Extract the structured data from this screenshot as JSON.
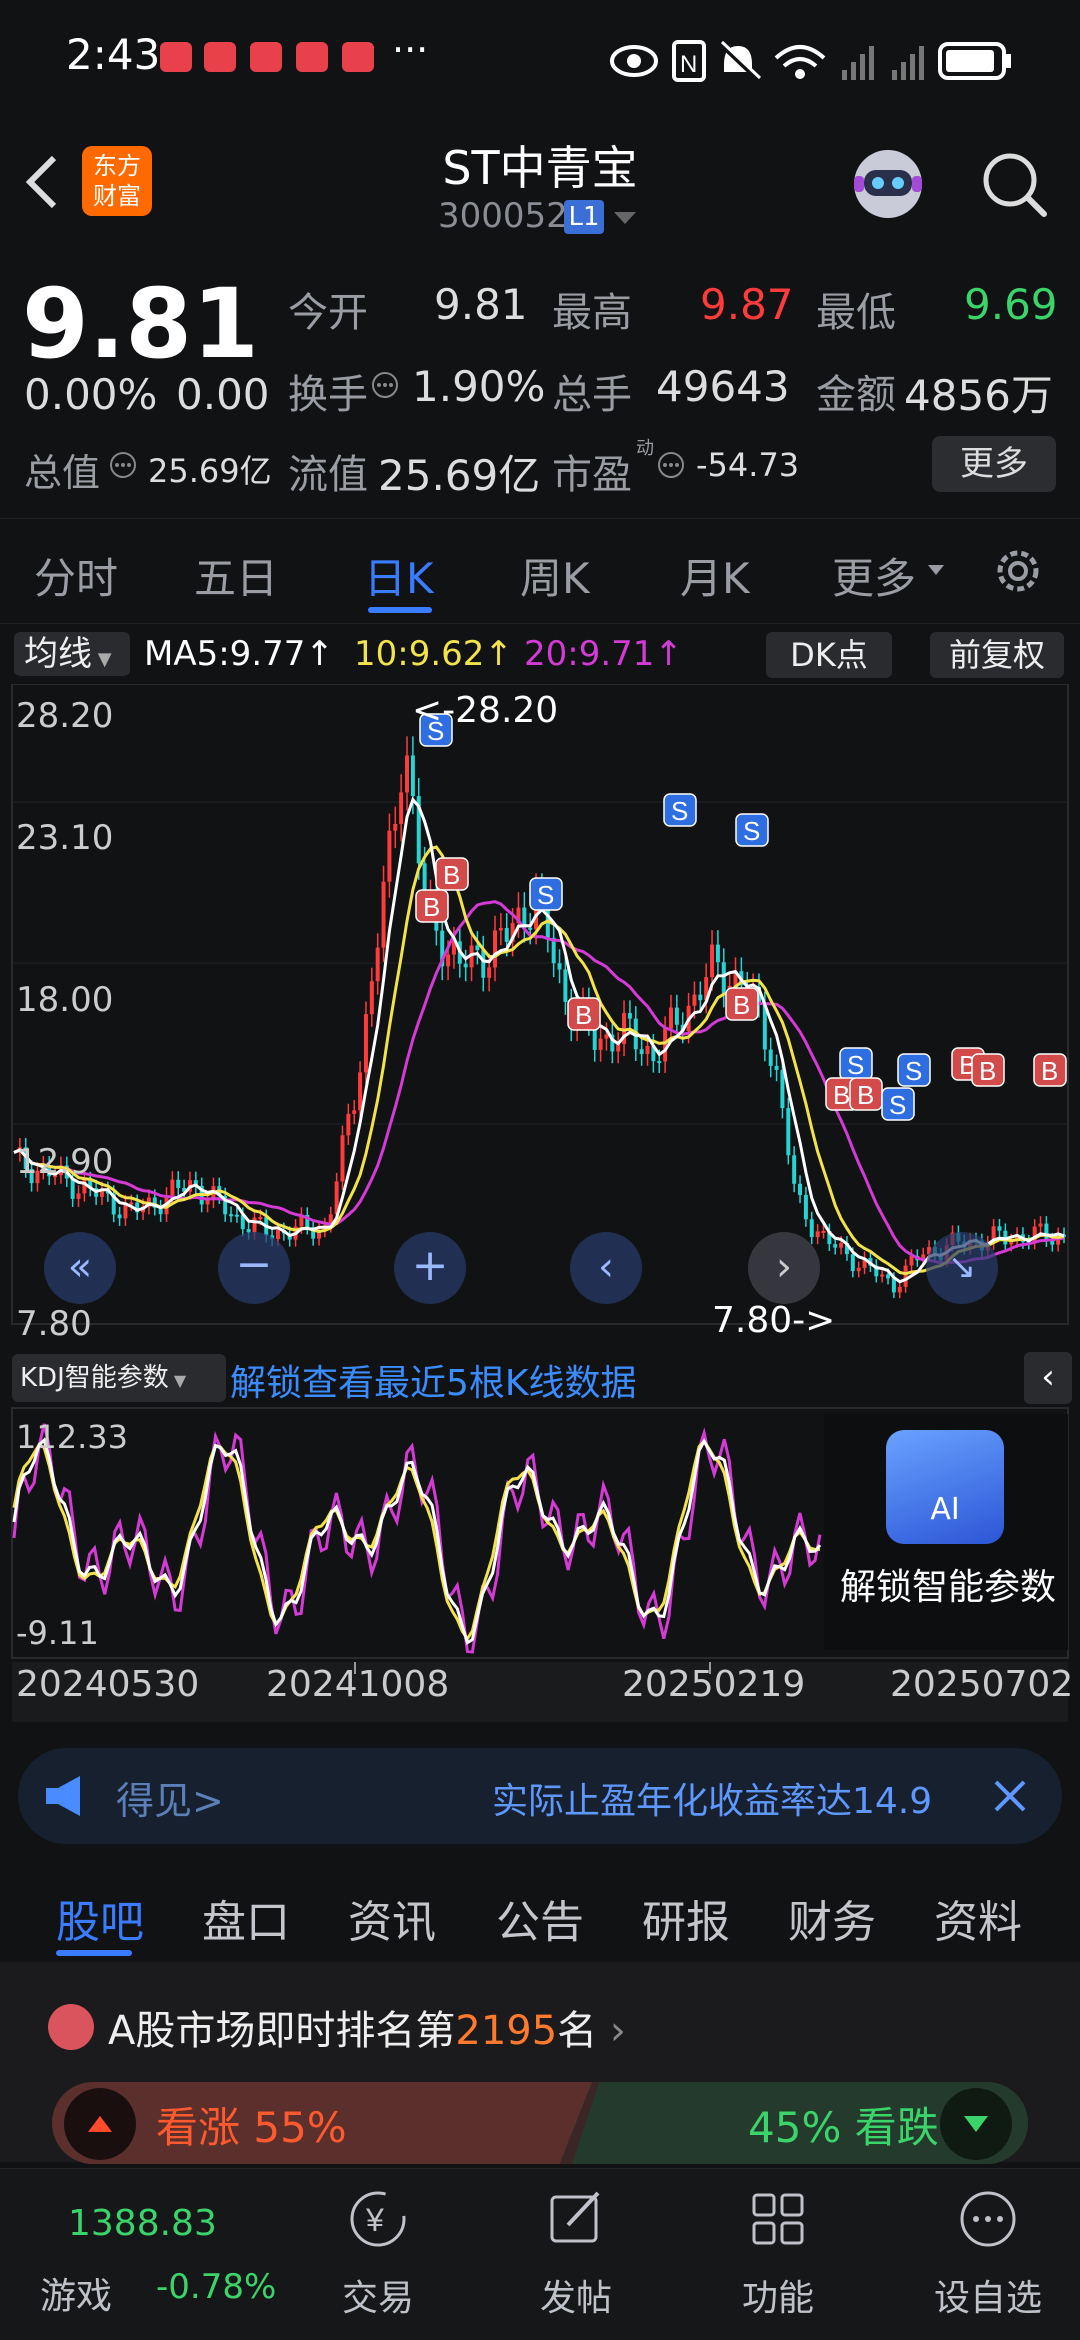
{
  "status_bar": {
    "time": "2:43",
    "more": "···"
  },
  "header": {
    "back_icon": "chevron-left-icon",
    "logo_text_1": "东方",
    "logo_text_2": "财富",
    "title": "ST中青宝",
    "code": "300052",
    "badge": "L1",
    "search_icon": "search-icon"
  },
  "quote": {
    "price": "9.81",
    "change_pct": "0.00%",
    "change": "0.00",
    "open_label": "今开",
    "open": "9.81",
    "high_label": "最高",
    "high": "9.87",
    "low_label": "最低",
    "low": "9.69",
    "turnover_label": "换手",
    "turnover": "1.90%",
    "volume_label": "总手",
    "volume": "49643",
    "amount_label": "金额",
    "amount": "4856万",
    "mcap_label": "总值",
    "mcap": "25.69亿",
    "float_label": "流值",
    "float": "25.69亿",
    "pe_label": "市盈",
    "pe_sup": "动",
    "pe": "-54.73",
    "more_button": "更多"
  },
  "tabs": [
    "分时",
    "五日",
    "日K",
    "周K",
    "月K",
    "更多"
  ],
  "chart": {
    "ma_selector": "均线",
    "ma5": "MA5:9.77↑",
    "ma10": "10:9.62↑",
    "ma20": "20:9.71↑",
    "dk_button": "DK点",
    "adjust_button": "前复权",
    "y_ticks": [
      "28.20",
      "23.10",
      "18.00",
      "12.90",
      "7.80"
    ],
    "max_label": "<-28.20",
    "min_label": "7.80->",
    "kdj_selector": "KDJ智能参数",
    "kdj_unlock": "解锁查看最近5根K线数据",
    "kdj_high": "112.33",
    "kdj_low": "-9.11",
    "ai_label": "AI",
    "ai_unlock": "解锁智能参数",
    "dates": [
      "20240530",
      "20241008",
      "20250219",
      "20250702"
    ],
    "colors": {
      "up": "#ff3b3b",
      "down": "#27d3d3",
      "ma5": "#ffffff",
      "ma10": "#f3e34a",
      "ma20": "#d43ad4"
    }
  },
  "banner": {
    "left": "得见>",
    "text": "实际止盈年化收益率达14.9"
  },
  "bottom_tabs": [
    "股吧",
    "盘口",
    "资讯",
    "公告",
    "研报",
    "财务",
    "资料"
  ],
  "rank": {
    "prefix": "A股市场即时排名第",
    "rank": "2195",
    "suffix": "名",
    "bull": "看涨 55%",
    "bear": "45% 看跌"
  },
  "bottom_nav": {
    "index_value": "1388.83",
    "game_label": "游戏",
    "index_change": "-0.78%",
    "items": [
      "交易",
      "发帖",
      "功能",
      "设自选"
    ]
  }
}
